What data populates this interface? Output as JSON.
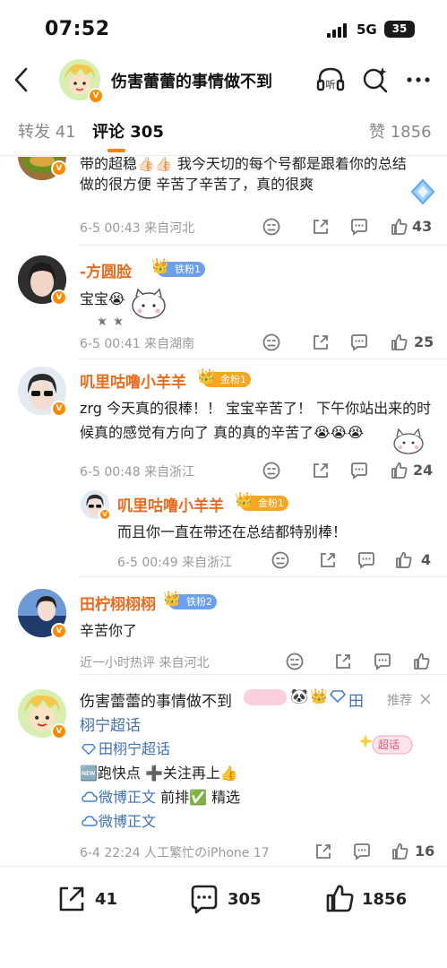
{
  "status_bar": {
    "time": "07:52",
    "network": "5G",
    "battery": "35"
  },
  "header": {
    "title": "伤害蕾蕾的事情做不到",
    "listen_label": "听"
  },
  "tabs": [
    {
      "label": "转发 41"
    },
    {
      "label": "评论 305"
    },
    {
      "label": "赞 1856"
    }
  ],
  "comments": [
    {
      "text_line1": "带的超稳👍🏻👍🏻 我今天切的每个号都是跟着你的总结",
      "text_line2": "做的很方便 辛苦了辛苦了，真的很爽",
      "meta": "6-5 00:43 来自河北",
      "likes": "43"
    },
    {
      "name": "-方圆脸",
      "badge": "铁粉1",
      "text": "宝宝😭",
      "meta": "6-5 00:41 来自湖南",
      "likes": "25"
    },
    {
      "name": "叽里咕噜小羊羊",
      "badge": "金粉1",
      "text_line1": "zrg 今天真的很棒！！ 宝宝辛苦了！ 下午你站出来的时",
      "text_line2": "候真的感觉有方向了 真的真的辛苦了😭😭😭",
      "meta": "6-5 00:48 来自浙江",
      "likes": "24"
    },
    {
      "name": "叽里咕噜小羊羊",
      "badge": "金粉1",
      "text": "而且你一直在带还在总结都特别棒！",
      "meta": "6-5 00:49 来自浙江",
      "likes": "4"
    },
    {
      "name": "田柠栩栩栩",
      "badge": "铁粉2",
      "text": "辛苦你了",
      "meta": "近一小时热评 来自河北",
      "likes": ""
    },
    {
      "name": "伤害蕾蕾的事情做不到",
      "name_suffix": "田",
      "name_line2": "栩宁超话",
      "recommend": "推荐",
      "line1": "田栩宁超话",
      "line2": "🆕跑快点 ➕关注再上👍",
      "line3_link": "微博正文",
      "line3_rest": " 前排✅ 精选",
      "line4_link": "微博正文",
      "super_topic_label": "超话",
      "meta": "6-4 22:24 人工繁忙のiPhone 17",
      "likes": "16"
    }
  ],
  "bottom_bar": {
    "reposts": "41",
    "comments": "305",
    "likes": "1856"
  }
}
